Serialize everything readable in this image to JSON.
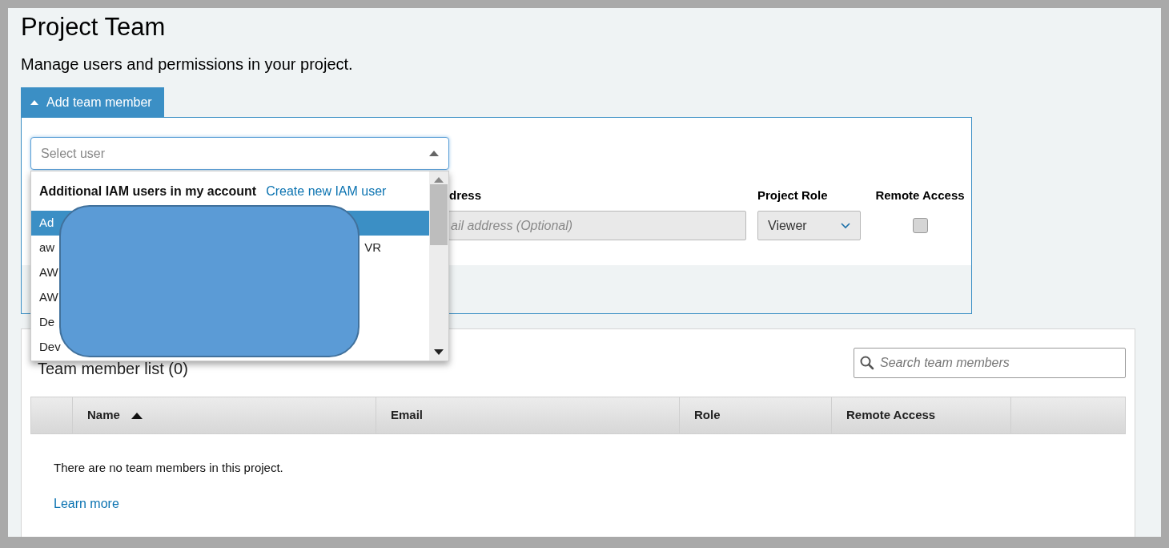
{
  "title": "Project Team",
  "subtitle": "Manage users and permissions in your project.",
  "add_member_toggle": {
    "label": "Add team member",
    "expanded": true
  },
  "user_select": {
    "placeholder": "Select user",
    "open": true
  },
  "dropdown": {
    "group_heading": "Additional IAM users in my account",
    "create_link": "Create new IAM user",
    "items": [
      {
        "text": "Ad",
        "selected": true
      },
      {
        "text": "aw",
        "trailing": "VR",
        "selected": false
      },
      {
        "text": "AW",
        "selected": false
      },
      {
        "text": "AW",
        "selected": false
      },
      {
        "text": "De",
        "selected": false
      },
      {
        "text": "Dev",
        "selected": false
      }
    ]
  },
  "form": {
    "email_label": "dress",
    "email_placeholder": "ail address (Optional)",
    "role_label": "Project Role",
    "role_value": "Viewer",
    "remote_label": "Remote Access",
    "remote_access_checked": false
  },
  "team_list": {
    "heading": "Team member list (0)",
    "search_placeholder": "Search team members",
    "columns": [
      {
        "label": "Name",
        "sorted": true
      },
      {
        "label": "Email",
        "sorted": false
      },
      {
        "label": "Role",
        "sorted": false
      },
      {
        "label": "Remote Access",
        "sorted": false
      }
    ],
    "empty_message": "There are no team members in this project.",
    "learn_more": "Learn more"
  }
}
